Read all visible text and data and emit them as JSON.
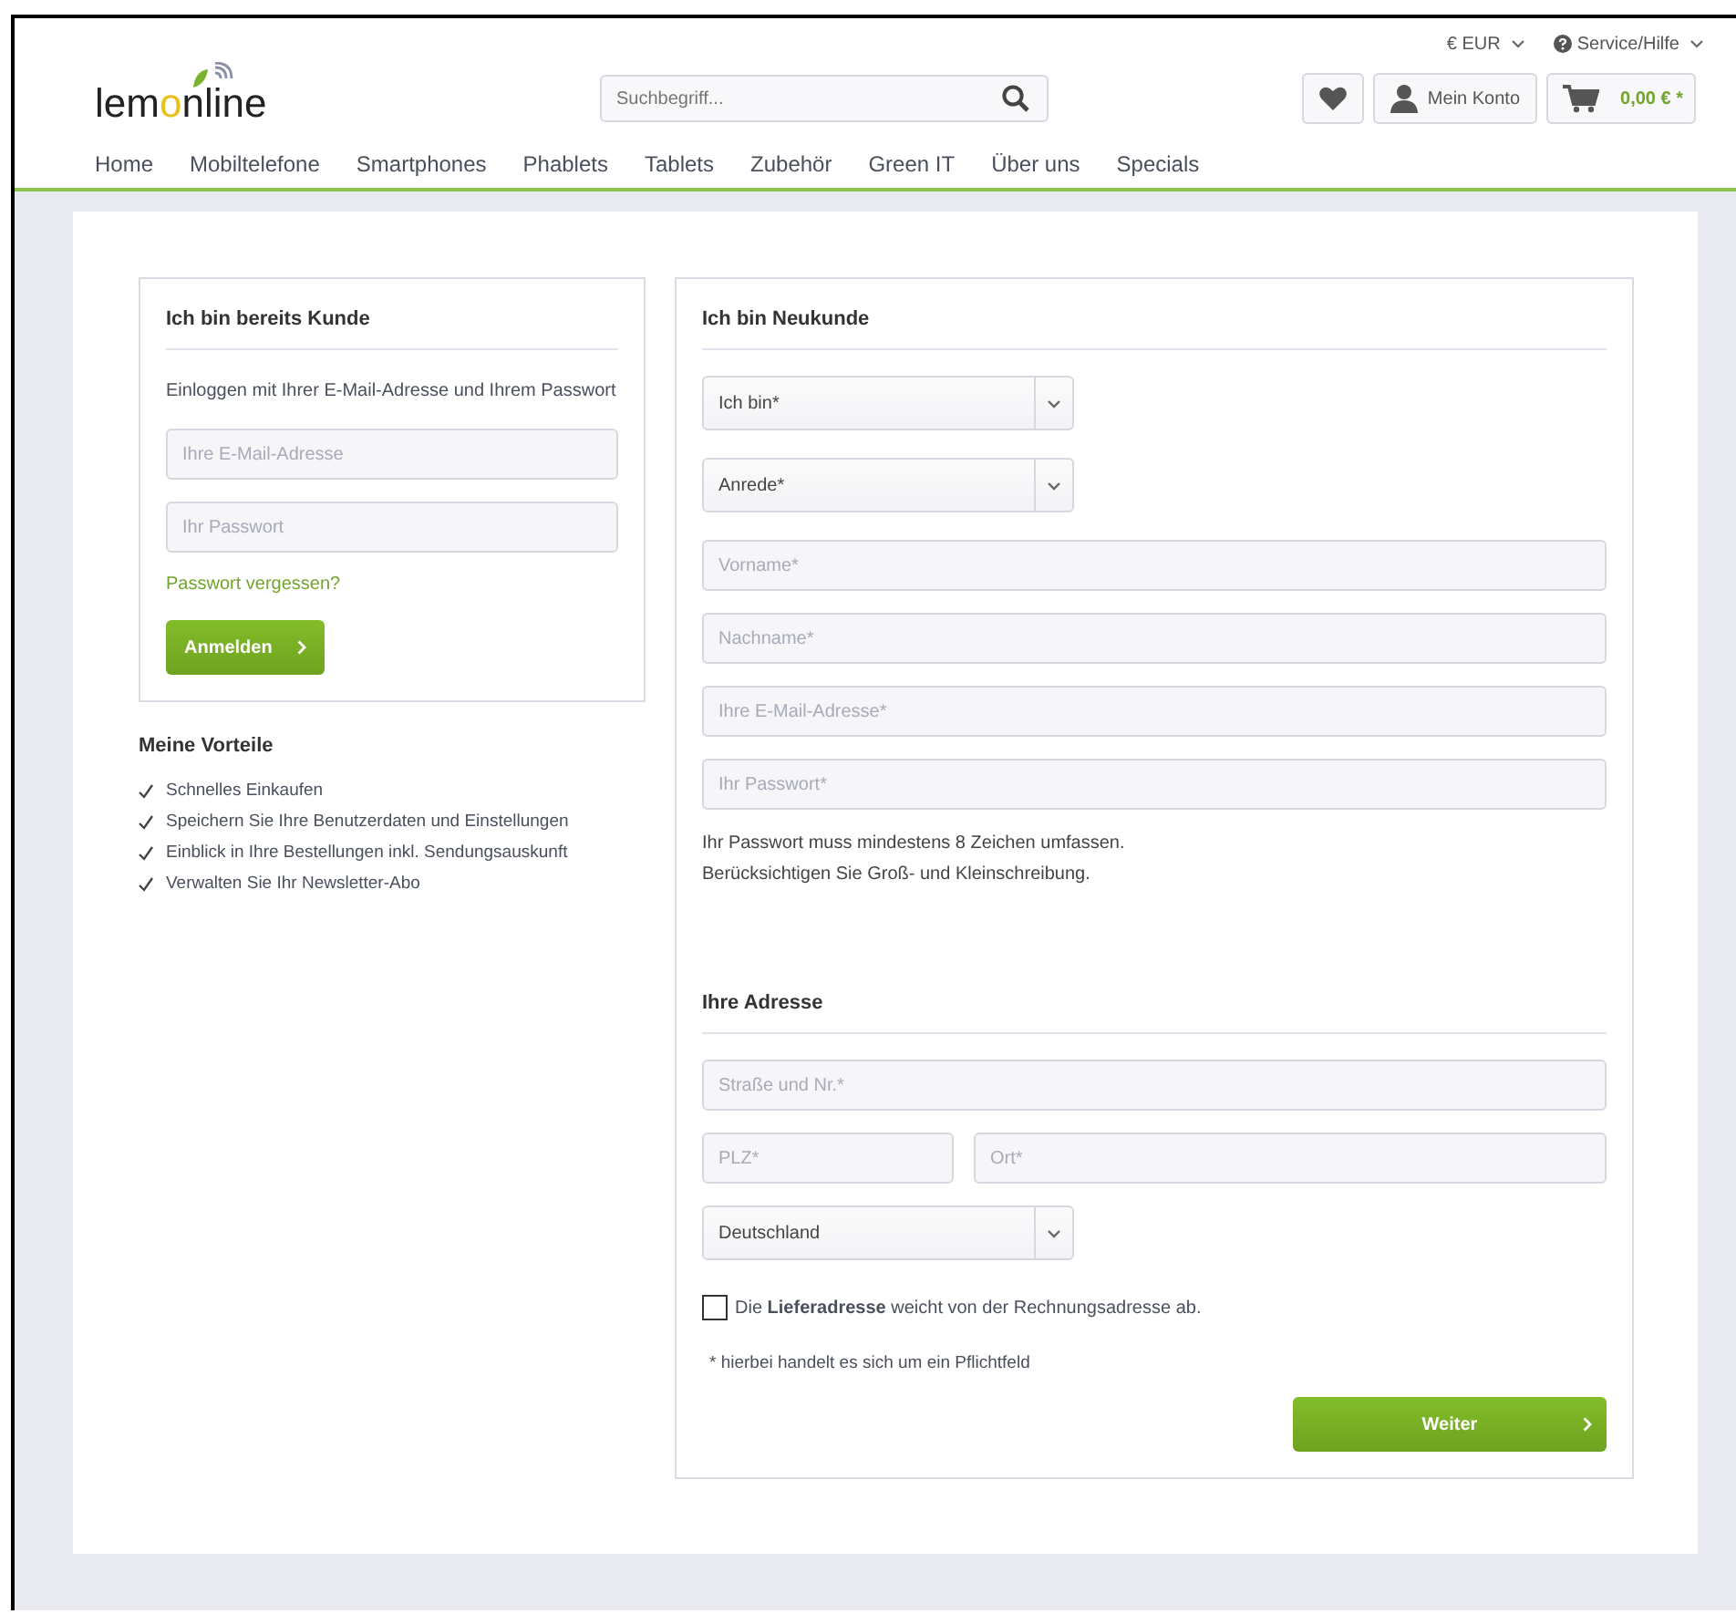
{
  "top_bar": {
    "currency": "€ EUR",
    "service": "Service/Hilfe"
  },
  "logo": {
    "parts": [
      "lem",
      "o",
      "nline"
    ]
  },
  "search": {
    "placeholder": "Suchbegriff..."
  },
  "account": {
    "label": "Mein Konto"
  },
  "cart": {
    "total": "0,00 € *"
  },
  "nav": [
    {
      "label": "Home"
    },
    {
      "label": "Mobiltelefone"
    },
    {
      "label": "Smartphones"
    },
    {
      "label": "Phablets"
    },
    {
      "label": "Tablets"
    },
    {
      "label": "Zubehör"
    },
    {
      "label": "Green IT"
    },
    {
      "label": "Über uns"
    },
    {
      "label": "Specials"
    }
  ],
  "login": {
    "title": "Ich bin bereits Kunde",
    "intro": "Einloggen mit Ihrer E-Mail-Adresse und Ihrem Passwort",
    "fields": [
      {
        "placeholder": "Ihre E-Mail-Adresse"
      },
      {
        "placeholder": "Ihr Passwort"
      }
    ],
    "forgot": "Passwort vergessen?",
    "button": "Anmelden"
  },
  "benefits": {
    "title": "Meine Vorteile",
    "items": [
      "Schnelles Einkaufen",
      "Speichern Sie Ihre Benutzerdaten und Einstellungen",
      "Einblick in Ihre Bestellungen inkl. Sendungsauskunft",
      "Verwalten Sie Ihr Newsletter-Abo"
    ]
  },
  "register": {
    "title": "Ich bin Neukunde",
    "fields": [
      {
        "kind": "select",
        "value": "Ich bin*"
      },
      {
        "kind": "select",
        "value": "Anrede*"
      },
      {
        "kind": "input",
        "placeholder": "Vorname*"
      },
      {
        "kind": "input",
        "placeholder": "Nachname*"
      },
      {
        "kind": "input",
        "placeholder": "Ihre E-Mail-Adresse*"
      },
      {
        "kind": "input",
        "placeholder": "Ihr Passwort*"
      }
    ],
    "password_hint": [
      "Ihr Passwort muss mindestens 8 Zeichen umfassen.",
      "Berücksichtigen Sie Groß- und Kleinschreibung."
    ],
    "address_title": "Ihre Adresse",
    "address_rows": [
      [
        {
          "kind": "input",
          "placeholder": "Straße und Nr.*"
        }
      ],
      [
        {
          "kind": "input",
          "placeholder": "PLZ*"
        },
        {
          "kind": "input",
          "placeholder": "Ort*"
        }
      ],
      [
        {
          "kind": "select",
          "value": "Deutschland"
        }
      ]
    ],
    "different_address": {
      "label": "Die **Lieferadresse** weicht von der Rechnungsadresse ab.",
      "checked": false
    },
    "required_note": "* hierbei handelt es sich um ein Pflichtfeld",
    "button": "Weiter"
  }
}
